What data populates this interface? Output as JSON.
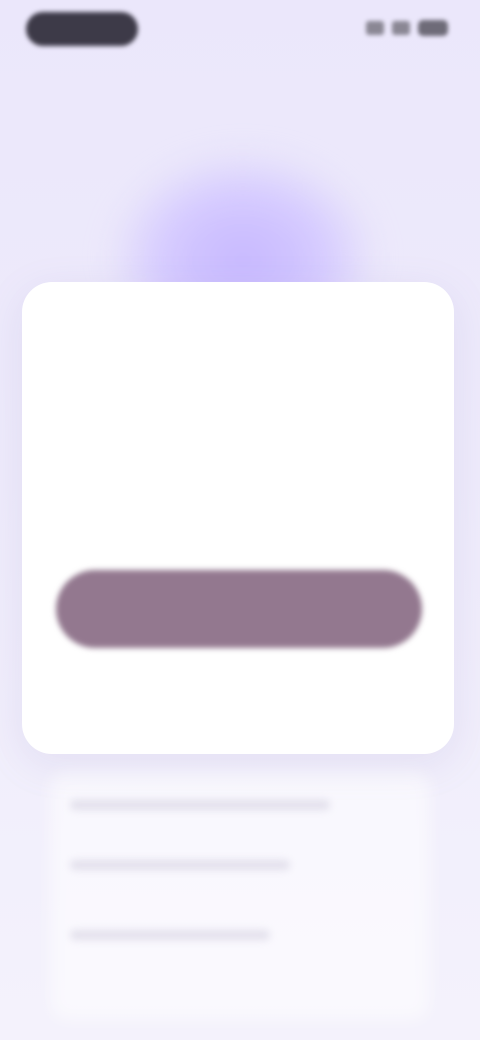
{
  "status_bar": {
    "time_icon": "status-pill",
    "signal_icon": "signal-icon",
    "wifi_icon": "wifi-icon",
    "battery_icon": "battery-icon"
  },
  "modal": {
    "title": "",
    "body": "",
    "note": "",
    "primary_button_label": "",
    "secondary_link": "",
    "footer_links": [
      "",
      ""
    ]
  },
  "colors": {
    "background": "#ebe7fb",
    "glow": "#c7b8ff",
    "card": "#ffffff",
    "primary_button": "#93788f"
  }
}
